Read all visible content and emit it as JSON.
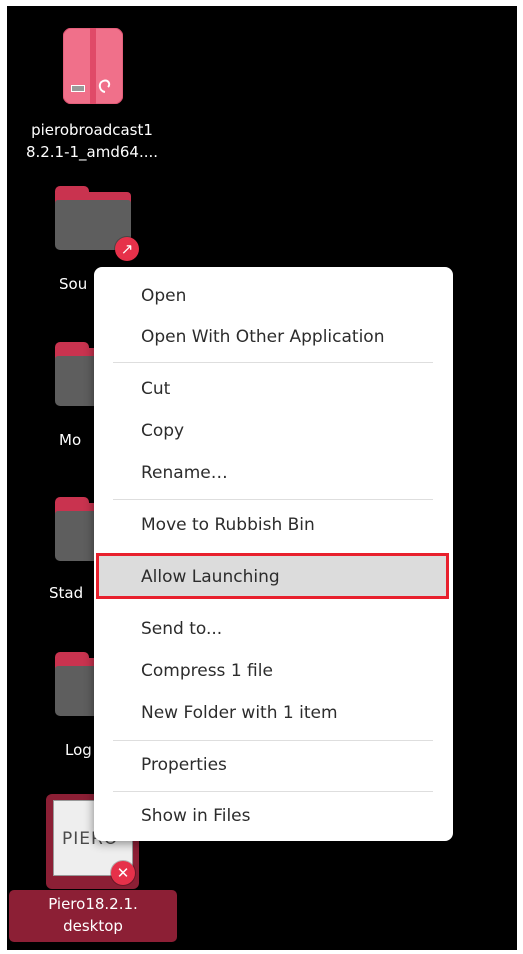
{
  "desktop": {
    "icons": [
      {
        "name": "pierobroadcast1 8.2.1-1_amd64....",
        "line1": "pierobroadcast1",
        "line2": "8.2.1-1_amd64....",
        "type": "debian-package"
      },
      {
        "name": "Sou",
        "type": "folder-link"
      },
      {
        "name": "Mo",
        "type": "folder"
      },
      {
        "name": "Stad",
        "type": "folder"
      },
      {
        "name": "Log",
        "type": "folder"
      },
      {
        "name": "Piero18.2.1. desktop",
        "line1": "Piero18.2.1.",
        "line2": "desktop",
        "thumb_text": "PIERO",
        "type": "desktop-file",
        "selected": true
      }
    ],
    "emblems": {
      "link": "↗",
      "unlaunchable": "✕"
    }
  },
  "context_menu": {
    "items": [
      {
        "label": "Open"
      },
      {
        "label": "Open With Other Application"
      },
      {
        "label": "Cut"
      },
      {
        "label": "Copy"
      },
      {
        "label": "Rename…"
      },
      {
        "label": "Move to Rubbish Bin"
      },
      {
        "label": "Allow Launching",
        "highlighted": true
      },
      {
        "label": "Send to..."
      },
      {
        "label": "Compress 1 file"
      },
      {
        "label": "New Folder with 1 item"
      },
      {
        "label": "Properties"
      },
      {
        "label": "Show in Files"
      }
    ]
  },
  "colors": {
    "desktop_bg": "#000000",
    "folder_accent": "#c9334f",
    "folder_body": "#5e5e5e",
    "emblem": "#e6314a",
    "highlight_border": "#e8202d",
    "selection": "#8c1f35"
  }
}
